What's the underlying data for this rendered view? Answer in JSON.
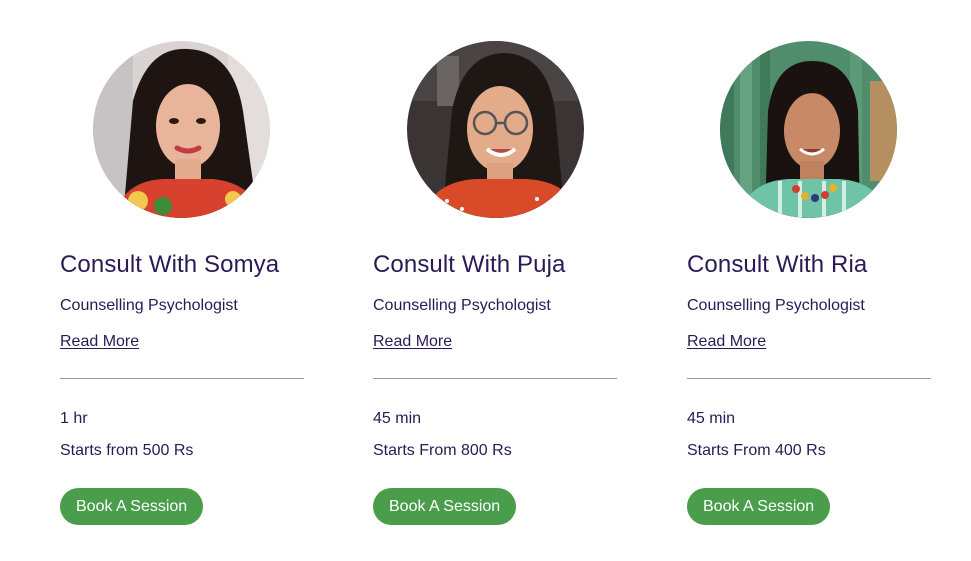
{
  "consultants": [
    {
      "title": "Consult With Somya",
      "role": "Counselling Psychologist",
      "read_more": "Read More",
      "duration": "1 hr",
      "price": "Starts from 500 Rs",
      "button": "Book A Session"
    },
    {
      "title": "Consult With Puja",
      "role": "Counselling Psychologist",
      "read_more": "Read More",
      "duration": "45 min",
      "price": "Starts From 800 Rs",
      "button": "Book A Session"
    },
    {
      "title": "Consult With Ria",
      "role": "Counselling Psychologist",
      "read_more": "Read More",
      "duration": "45 min",
      "price": "Starts From 400 Rs",
      "button": "Book A Session"
    }
  ],
  "colors": {
    "text": "#2a1a55",
    "button_bg": "#4a9d4b",
    "button_text": "#ffffff",
    "divider": "#9a9a9a"
  }
}
